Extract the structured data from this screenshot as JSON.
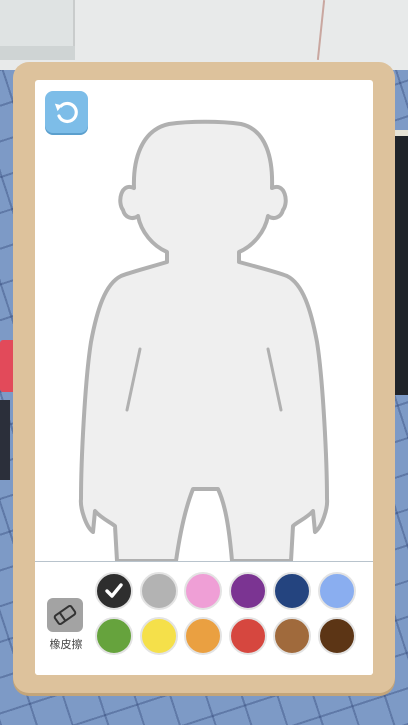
{
  "toolbar": {
    "undo_icon": "undo-arrow-icon",
    "eraser_icon": "eraser-icon",
    "eraser_label": "橡皮擦"
  },
  "palette": {
    "selected_index": 0,
    "colors": [
      {
        "name": "black",
        "hex": "#2e2e2e"
      },
      {
        "name": "gray",
        "hex": "#b3b3b3"
      },
      {
        "name": "pink",
        "hex": "#ef9fd6"
      },
      {
        "name": "purple",
        "hex": "#7b3492"
      },
      {
        "name": "navy",
        "hex": "#24447f"
      },
      {
        "name": "light-blue",
        "hex": "#8aaef0"
      },
      {
        "name": "green",
        "hex": "#66a33d"
      },
      {
        "name": "yellow",
        "hex": "#f5e04a"
      },
      {
        "name": "orange",
        "hex": "#eaa041"
      },
      {
        "name": "red",
        "hex": "#d6473f"
      },
      {
        "name": "brown",
        "hex": "#a06a3c"
      },
      {
        "name": "dark-brown",
        "hex": "#5c3515"
      }
    ]
  },
  "figure": {
    "fill": "#efefef",
    "outline": "#b0b0b0"
  }
}
